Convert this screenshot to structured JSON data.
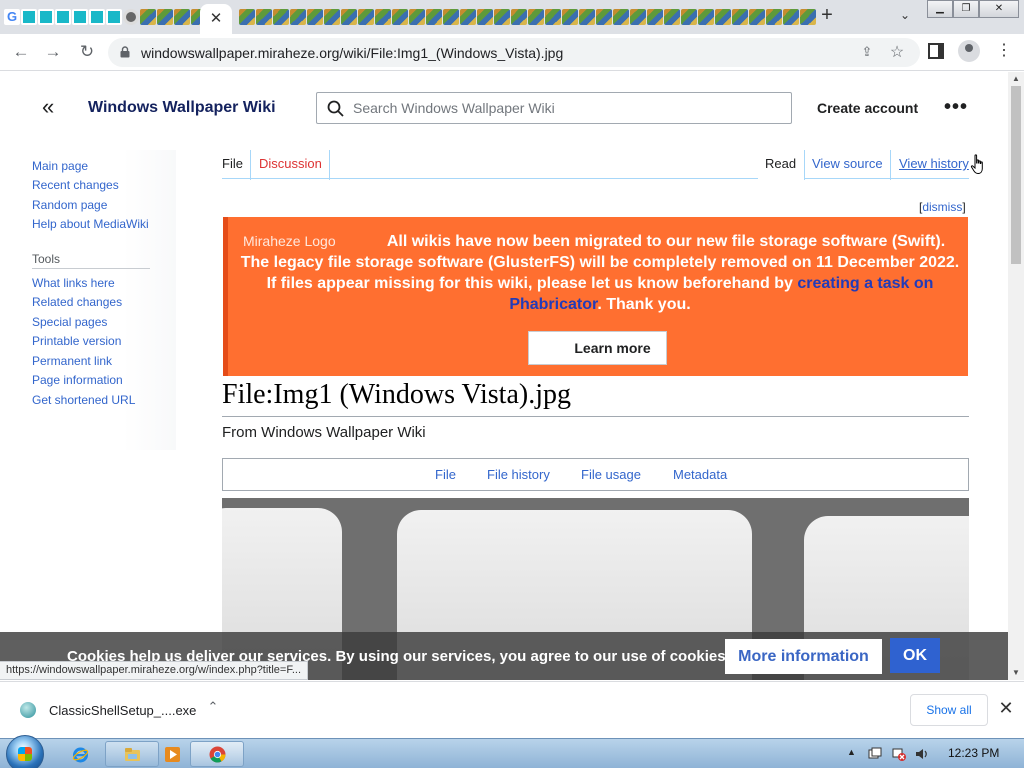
{
  "browser": {
    "active_tab_close": "✕",
    "new_tab": "+",
    "tab_search": "⌄",
    "window_buttons": [
      "▁",
      "❐",
      "✕"
    ],
    "url": "windowswallpaper.miraheze.org/wiki/File:Img1_(Windows_Vista).jpg",
    "menu": "⋮",
    "status_url": "https://windowswallpaper.miraheze.org/w/index.php?title=F..."
  },
  "wiki": {
    "site_title": "Windows Wallpaper Wiki",
    "search_placeholder": "Search Windows Wallpaper Wiki",
    "create_account": "Create account",
    "more": "•••",
    "collapse": "«"
  },
  "sidebar": {
    "nav": [
      "Main page",
      "Recent changes",
      "Random page",
      "Help about MediaWiki"
    ],
    "tools_heading": "Tools",
    "tools": [
      "What links here",
      "Related changes",
      "Special pages",
      "Printable version",
      "Permanent link",
      "Page information",
      "Get shortened URL"
    ]
  },
  "page_tabs": {
    "file": "File",
    "discussion": "Discussion",
    "read": "Read",
    "view_source": "View source",
    "view_history": "View history"
  },
  "banner": {
    "dismiss_open": "[",
    "dismiss": "dismiss",
    "dismiss_close": "]",
    "logo_alt": "Miraheze Logo",
    "text_before": "All wikis have now been migrated to our new file storage software (Swift). The legacy file storage software (GlusterFS) will be completely removed on 11 December 2022. If files appear missing for this wiki, please let us know beforehand by ",
    "link": "creating a task on Phabricator",
    "text_after": ". Thank you.",
    "button": "Learn more",
    "colors": {
      "background": "#ff6f30",
      "border": "#e54c18",
      "link": "#223bb8"
    }
  },
  "content": {
    "title": "File:Img1 (Windows Vista).jpg",
    "subtitle": "From Windows Wallpaper Wiki",
    "file_nav": [
      "File",
      "File history",
      "File usage",
      "Metadata"
    ]
  },
  "cookie": {
    "text": "Cookies help us deliver our services. By using our services, you agree to our use of cookies.",
    "more_info": "More information",
    "ok": "OK"
  },
  "downloads": {
    "file_name": "ClassicShellSetup_....exe",
    "chevron": "⌃",
    "show_all": "Show all",
    "close": "✕"
  },
  "taskbar": {
    "tray_arrow": "▲",
    "clock": "12:23 PM",
    "pinned": [
      "internet-explorer-icon",
      "explorer-folder-icon",
      "media-player-icon",
      "chrome-icon"
    ]
  }
}
